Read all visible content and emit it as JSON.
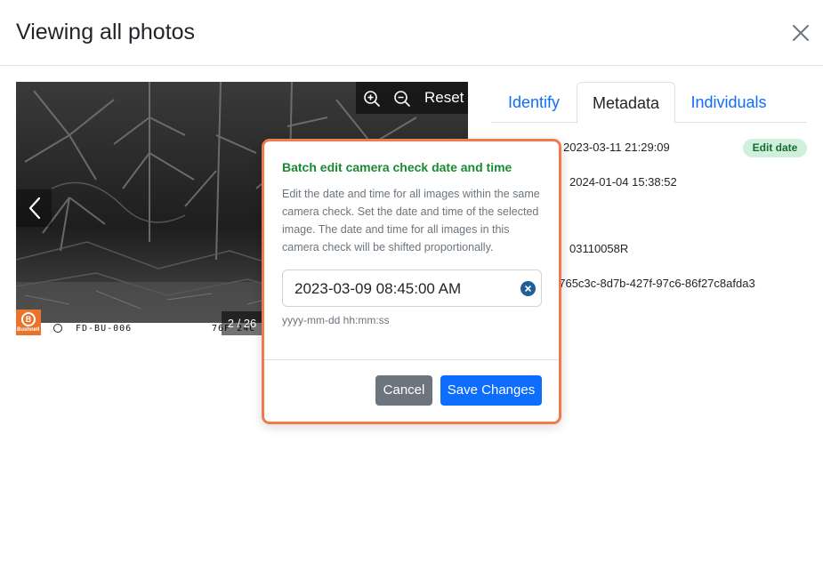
{
  "header": {
    "title": "Viewing all photos"
  },
  "viewer": {
    "reset_label": "Reset",
    "counter": "2 / 26",
    "camera_id": "FD-BU-006",
    "temp_text": "76F 24C",
    "logo_text": "Bushnell"
  },
  "tabs": [
    {
      "label": "Identify"
    },
    {
      "label": "Metadata"
    },
    {
      "label": "Individuals"
    }
  ],
  "metadata": {
    "value1": "2023-03-11 21:29:09",
    "edit_date_label": "Edit date",
    "value2": "2024-01-04 15:38:52",
    "value3": "03110058R",
    "value4": "e765c3c-8d7b-427f-97c6-86f27c8afda3"
  },
  "popover": {
    "title": "Batch edit camera check date and time",
    "description": "Edit the date and time for all images within the same camera check. Set the date and time of the selected image. The date and time for all images in this camera check will be shifted proportionally.",
    "date_value": "2023-03-09 08:45:00 AM",
    "date_hint": "yyyy-mm-dd hh:mm:ss",
    "cancel_label": "Cancel",
    "save_label": "Save Changes"
  },
  "colors": {
    "accent": "#0d6efd",
    "popover_border": "#f07a4d",
    "title_green": "#198a2f",
    "badge_bg": "#d1f0dc"
  }
}
